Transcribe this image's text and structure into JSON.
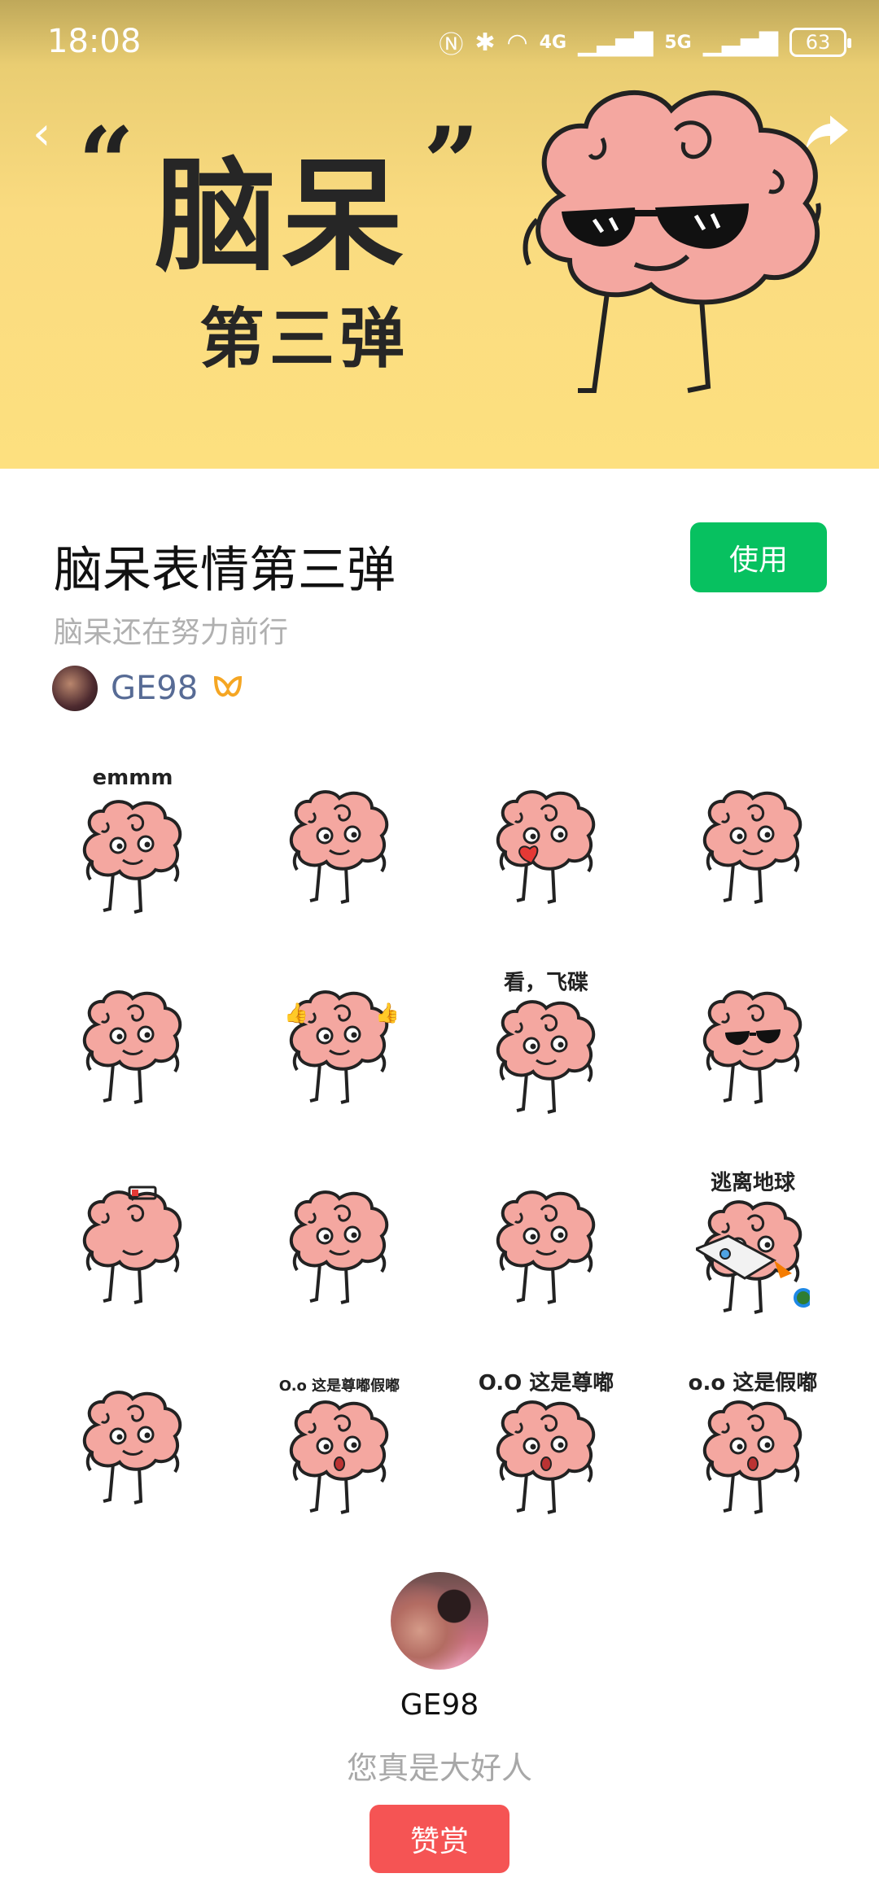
{
  "status_bar": {
    "time": "18:08",
    "net1": "4G",
    "net2": "5G",
    "battery": "63"
  },
  "banner": {
    "quote_open": "“",
    "title": "脑呆",
    "quote_close": "”",
    "subtitle": "第三弹"
  },
  "pack": {
    "title": "脑呆表情第三弹",
    "use_label": "使用",
    "description": "脑呆还在努力前行",
    "author": "GE98"
  },
  "stickers": [
    {
      "caption": "emmm",
      "icon": "brain-emmm-icon"
    },
    {
      "caption": "",
      "icon": "brain-shocked-icon"
    },
    {
      "caption": "",
      "icon": "brain-heart-kiss-icon"
    },
    {
      "caption": "",
      "icon": "brain-unimpressed-icon"
    },
    {
      "caption": "",
      "icon": "brain-sweat-icon"
    },
    {
      "caption": "",
      "icon": "brain-thumbs-up-icon"
    },
    {
      "caption": "看，飞碟",
      "icon": "brain-pointing-icon"
    },
    {
      "caption": "",
      "icon": "brain-sunglasses-icon"
    },
    {
      "caption": "",
      "icon": "brain-low-battery-icon"
    },
    {
      "caption": "",
      "icon": "brain-angry-icon"
    },
    {
      "caption": "",
      "icon": "brain-irritated-icon"
    },
    {
      "caption": "逃离地球",
      "icon": "brain-rocket-icon"
    },
    {
      "caption": "",
      "icon": "brain-sleepy-icon"
    },
    {
      "caption": "O.o 这是尊嘟假嘟",
      "icon": "brain-surprised-icon"
    },
    {
      "caption": "O.O 这是尊嘟",
      "icon": "brain-surprised-2-icon"
    },
    {
      "caption": "o.o 这是假嘟",
      "icon": "brain-surprised-3-icon"
    }
  ],
  "footer": {
    "name": "GE98",
    "thanks": "您真是大好人",
    "reward_label": "赞赏"
  },
  "colors": {
    "use_button": "#07c160",
    "reward_button": "#f55454",
    "brain": "#f4a7a0",
    "author_link": "#576b95"
  }
}
